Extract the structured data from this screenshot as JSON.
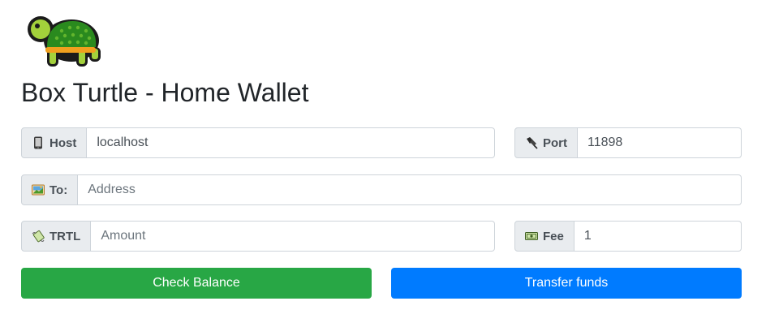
{
  "app": {
    "title": "Box Turtle - Home Wallet",
    "logo_icon": "turtle-icon"
  },
  "form": {
    "host": {
      "label": "Host",
      "icon": "mobile-phone-icon",
      "value": "localhost",
      "placeholder": ""
    },
    "port": {
      "label": "Port",
      "icon": "plug-icon",
      "value": "11898",
      "placeholder": ""
    },
    "to": {
      "label": "To:",
      "icon": "postcard-icon",
      "value": "",
      "placeholder": "Address"
    },
    "amount": {
      "label": "TRTL",
      "icon": "money-with-wings-icon",
      "value": "",
      "placeholder": "Amount"
    },
    "fee": {
      "label": "Fee",
      "icon": "banknote-icon",
      "value": "1",
      "placeholder": ""
    }
  },
  "buttons": {
    "check_balance": {
      "label": "Check Balance",
      "color": "#28a745"
    },
    "transfer": {
      "label": "Transfer funds",
      "color": "#007bff"
    }
  }
}
